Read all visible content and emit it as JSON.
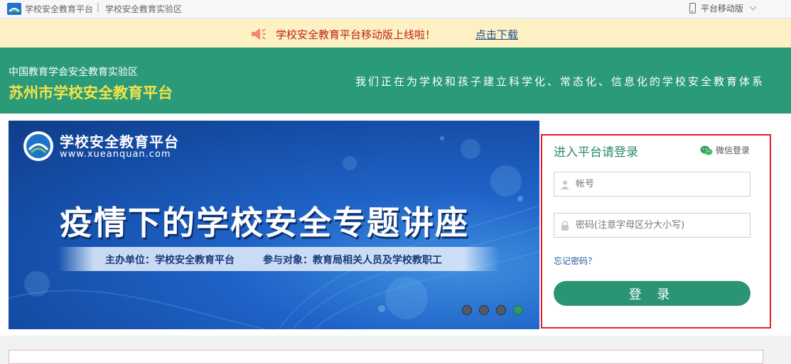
{
  "topbar": {
    "site_name": "学校安全教育平台",
    "separator": "|",
    "lab_name": "学校安全教育实验区",
    "mobile_label": "平台移动版"
  },
  "notice": {
    "message": "学校安全教育平台移动版上线啦！",
    "download": "点击下载"
  },
  "header": {
    "subtitle": "中国教育学会安全教育实验区",
    "title": "苏州市学校安全教育平台",
    "slogan": "我们正在为学校和孩子建立科学化、常态化、信息化的学校安全教育体系"
  },
  "banner": {
    "brand": "学校安全教育平台",
    "url": "www.xueanquan.com",
    "headline": "疫情下的学校安全专题讲座",
    "host": "主办单位：学校安全教育平台",
    "audience": "参与对象：教育局相关人员及学校教职工",
    "slide_count": 4,
    "active_slide": 4
  },
  "login": {
    "title": "进入平台请登录",
    "wechat": "微信登录",
    "username_placeholder": "帐号",
    "password_placeholder": "密码(注意字母区分大小写)",
    "forgot": "忘记密码？",
    "submit": "登 录"
  },
  "colors": {
    "header_green": "#2a9a78",
    "title_yellow": "#f3e34a",
    "notice_bg": "#fdf0c2",
    "notice_red": "#c0201a",
    "login_border_red": "#e0202a",
    "button_green": "#2b9474"
  }
}
